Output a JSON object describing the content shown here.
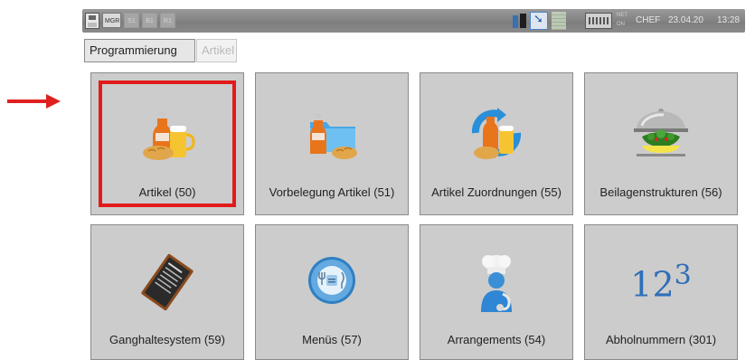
{
  "statusbar": {
    "mode_buttons": [
      "MGR",
      "S1",
      "B1",
      "R1"
    ],
    "net_label": "NET",
    "net_state": "ON",
    "user": "CHEF",
    "date": "23.04.20",
    "time": "13:28"
  },
  "breadcrumb": {
    "items": [
      "Programmierung",
      "Artikel"
    ]
  },
  "tiles": [
    {
      "label": "Artikel (50)",
      "icon": "drink-bread-icon",
      "selected": true
    },
    {
      "label": "Vorbelegung Artikel (51)",
      "icon": "folder-drink-icon"
    },
    {
      "label": "Artikel Zuordnungen (55)",
      "icon": "drink-cycle-icon"
    },
    {
      "label": "Beilagenstrukturen (56)",
      "icon": "cloche-salad-icon"
    },
    {
      "label": "Ganghaltesystem (59)",
      "icon": "chalkboard-icon"
    },
    {
      "label": "Menüs (57)",
      "icon": "menu-plate-icon"
    },
    {
      "label": "Arrangements (54)",
      "icon": "chef-icon"
    },
    {
      "label": "Abholnummern (301)",
      "icon": "numbers-icon"
    }
  ],
  "numbers_icon": {
    "base": "12",
    "sup": "3"
  },
  "colors": {
    "selection": "#e11b1b",
    "arrow": "#e02020",
    "tile_bg": "#cccccc"
  }
}
